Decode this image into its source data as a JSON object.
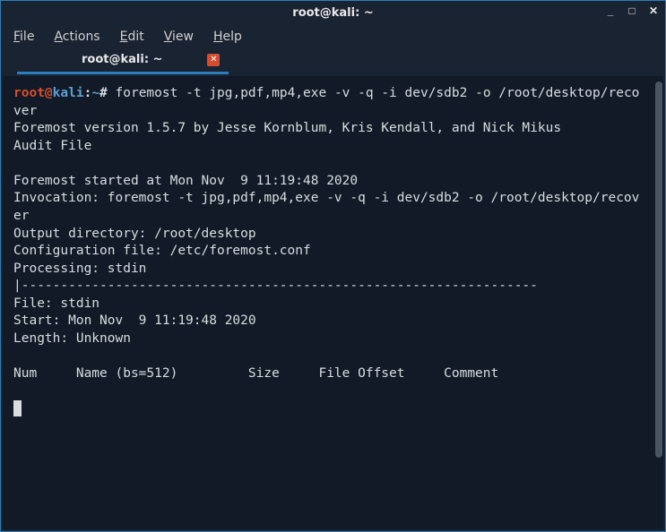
{
  "window": {
    "title": "root@kali: ~"
  },
  "menu": {
    "file": "File",
    "actions": "Actions",
    "edit": "Edit",
    "view": "View",
    "help": "Help"
  },
  "tab": {
    "label": "root@kali: ~"
  },
  "prompt": {
    "user": "root",
    "at": "@",
    "host": "kali",
    "colon": ":",
    "path": "~",
    "hash": "# "
  },
  "terminal": {
    "command": "foremost -t jpg,pdf,mp4,exe -v -q -i dev/sdb2 -o /root/desktop/recover",
    "out1": "Foremost version 1.5.7 by Jesse Kornblum, Kris Kendall, and Nick Mikus",
    "out2": "Audit File",
    "blank": " ",
    "out3": "Foremost started at Mon Nov  9 11:19:48 2020",
    "out4": "Invocation: foremost -t jpg,pdf,mp4,exe -v -q -i dev/sdb2 -o /root/desktop/recover",
    "out5": "Output directory: /root/desktop",
    "out6": "Configuration file: /etc/foremost.conf",
    "out7": "Processing: stdin",
    "out8": "|------------------------------------------------------------------",
    "out9": "File: stdin",
    "out10": "Start: Mon Nov  9 11:19:48 2020",
    "out11": "Length: Unknown",
    "header": "Num     Name (bs=512)         Size     File Offset     Comment"
  }
}
